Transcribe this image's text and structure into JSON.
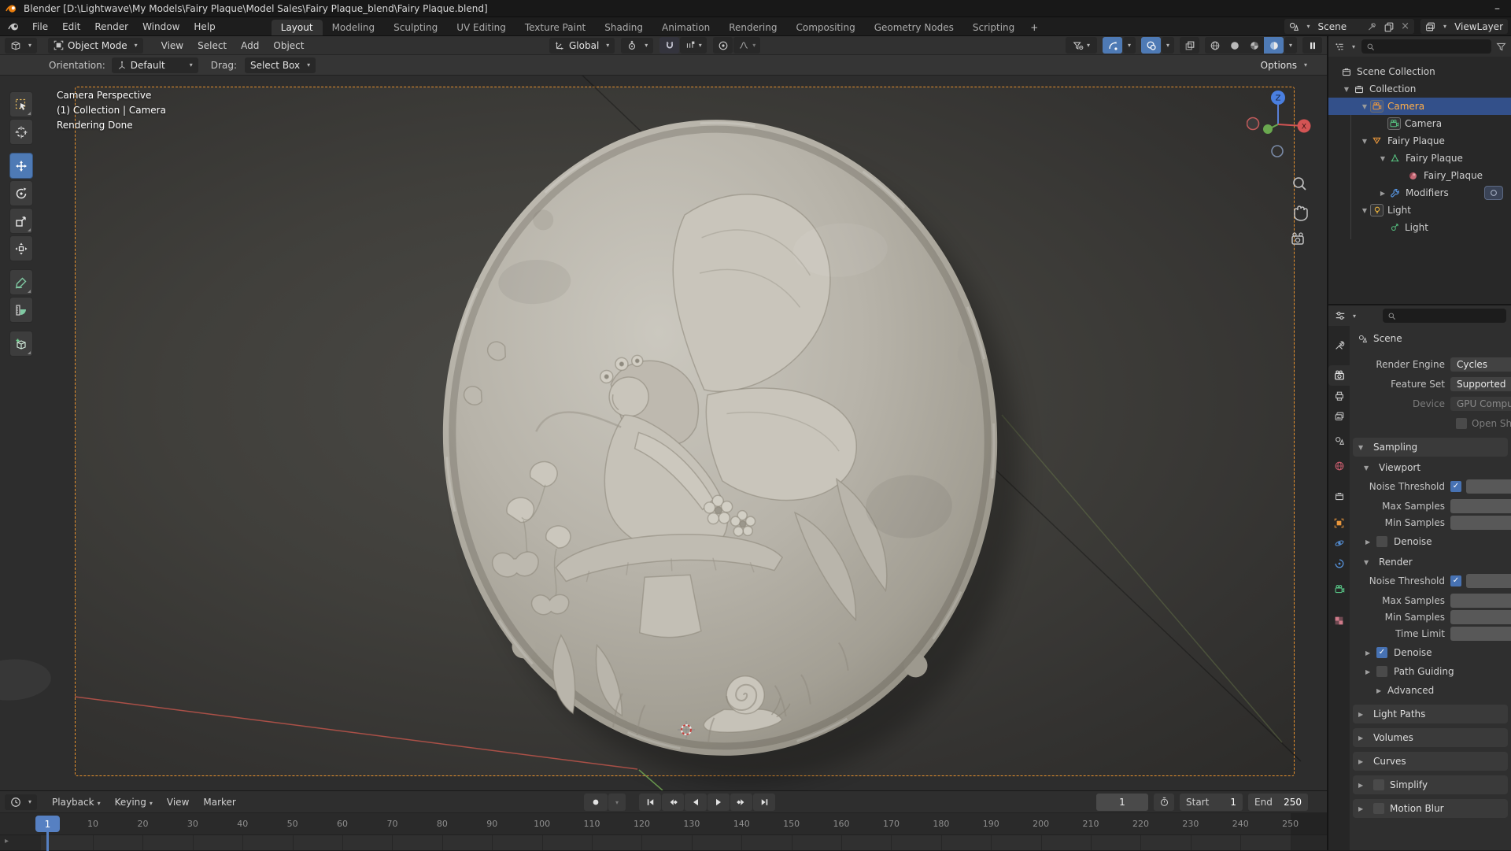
{
  "window": {
    "title": "Blender [D:\\Lightwave\\My Models\\Fairy Plaque\\Model Sales\\Fairy Plaque_blend\\Fairy Plaque.blend]",
    "minimize_glyph": "–"
  },
  "topbar": {
    "menus": [
      "File",
      "Edit",
      "Render",
      "Window",
      "Help"
    ],
    "tabs": [
      "Layout",
      "Modeling",
      "Sculpting",
      "UV Editing",
      "Texture Paint",
      "Shading",
      "Animation",
      "Rendering",
      "Compositing",
      "Geometry Nodes",
      "Scripting"
    ],
    "active_tab": "Layout",
    "add_tab_glyph": "+",
    "scene_name": "Scene",
    "view_layer_name": "ViewLayer"
  },
  "viewport": {
    "mode": "Object Mode",
    "menus": [
      "View",
      "Select",
      "Add",
      "Object"
    ],
    "orientation": "Global",
    "tool_settings": {
      "orientation_label": "Orientation:",
      "orientation_value": "Default",
      "drag_label": "Drag:",
      "drag_value": "Select Box",
      "options_label": "Options"
    },
    "overlay": {
      "line1": "Camera Perspective",
      "line2": "(1) Collection | Camera",
      "line3": "Rendering Done"
    },
    "gizmo": {
      "z": "Z",
      "x": "X"
    }
  },
  "outliner": {
    "rows": [
      {
        "label": "Scene Collection"
      },
      {
        "label": "Collection"
      },
      {
        "label": "Camera"
      },
      {
        "label": "Camera"
      },
      {
        "label": "Fairy Plaque"
      },
      {
        "label": "Fairy Plaque"
      },
      {
        "label": "Fairy_Plaque"
      },
      {
        "label": "Modifiers"
      },
      {
        "label": "Light"
      },
      {
        "label": "Light"
      }
    ]
  },
  "properties": {
    "breadcrumb": "Scene",
    "render_engine_label": "Render Engine",
    "render_engine_value": "Cycles",
    "feature_set_label": "Feature Set",
    "feature_set_value": "Supported",
    "device_label": "Device",
    "device_value": "GPU Compute",
    "osl_label": "Open Shading Language",
    "sampling": {
      "title": "Sampling",
      "viewport_title": "Viewport",
      "render_title": "Render",
      "noise_threshold": "Noise Threshold",
      "max_samples": "Max Samples",
      "min_samples": "Min Samples",
      "time_limit": "Time Limit",
      "denoise": "Denoise",
      "path_guiding": "Path Guiding",
      "advanced": "Advanced"
    },
    "sections": [
      "Light Paths",
      "Volumes",
      "Curves",
      "Simplify",
      "Motion Blur"
    ]
  },
  "timeline": {
    "menus": [
      "Playback",
      "Keying",
      "View",
      "Marker"
    ],
    "current_frame": "1",
    "start_label": "Start",
    "start_value": "1",
    "end_label": "End",
    "end_value": "250",
    "playhead_label": "1",
    "frame_labels": [
      10,
      20,
      30,
      40,
      50,
      60,
      70,
      80,
      90,
      100,
      110,
      120,
      130,
      140,
      150,
      160,
      170,
      180,
      190,
      200,
      210,
      220,
      230,
      240,
      250
    ]
  },
  "colors": {
    "accent_blue": "#4772b3",
    "selection_blue": "#33508a",
    "active_object_text": "#ffae4a",
    "camera_border_orange": "#e8912d"
  }
}
